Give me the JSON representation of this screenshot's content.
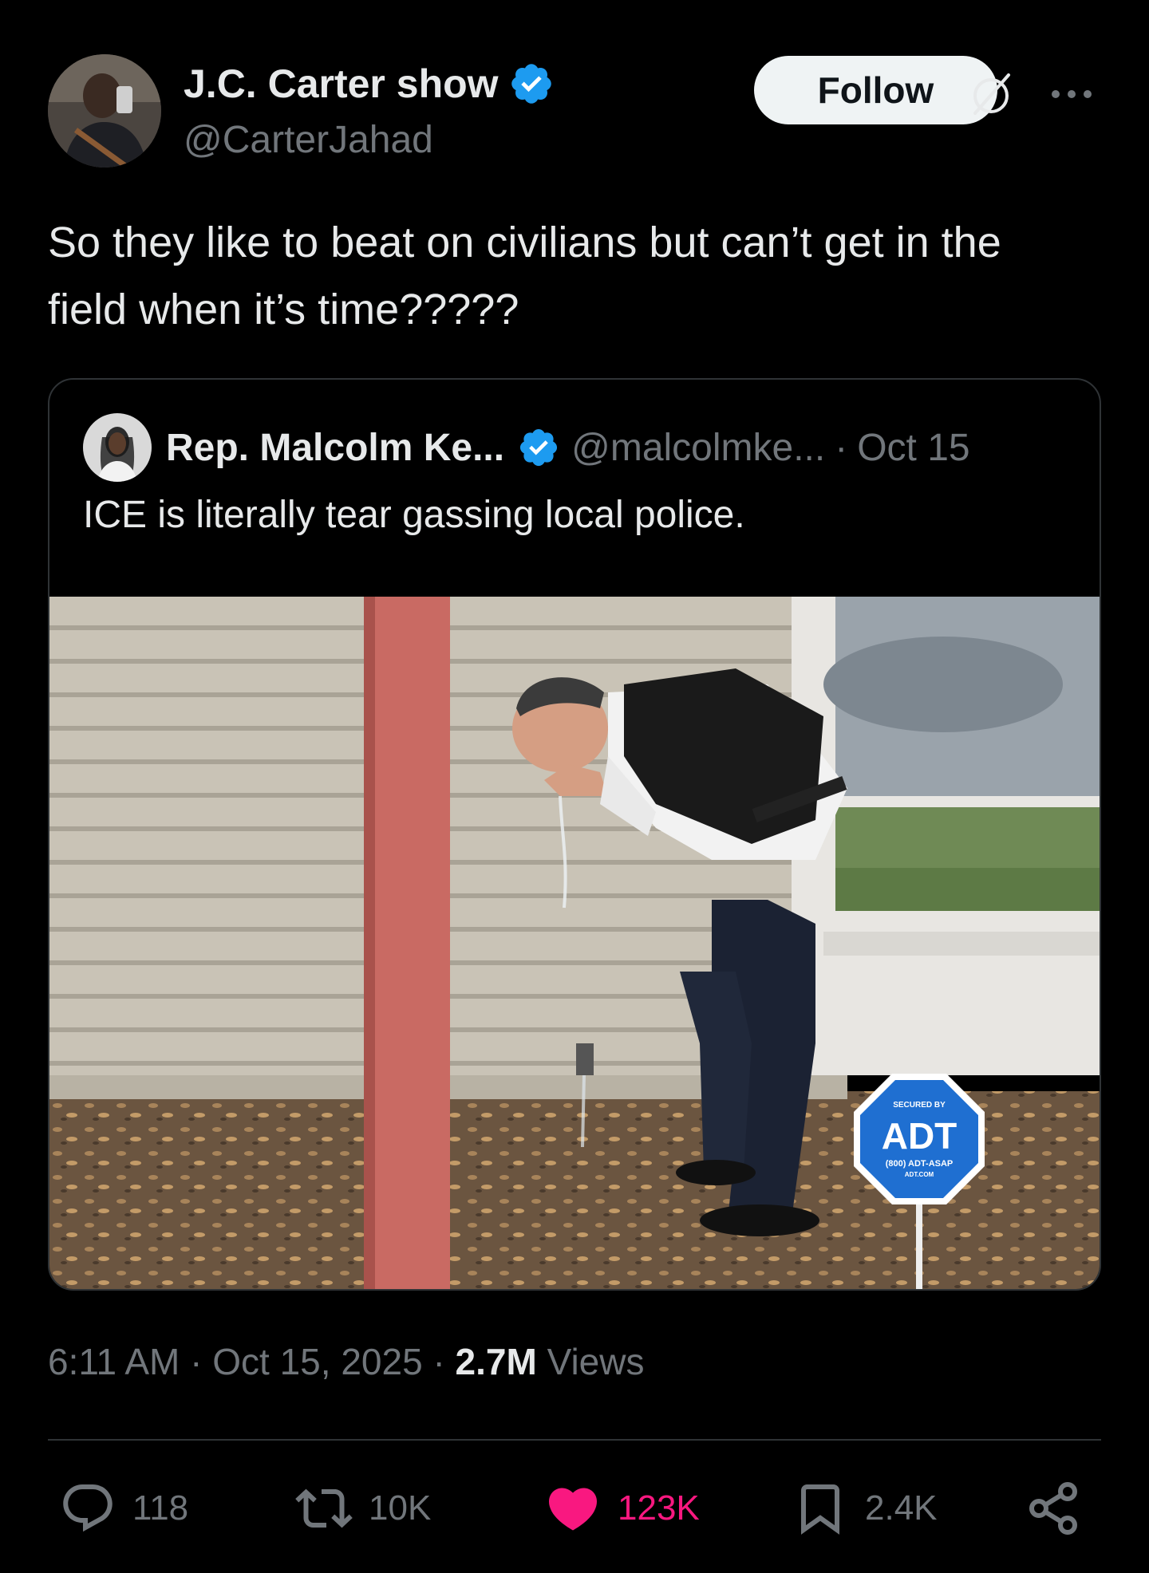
{
  "post": {
    "author": {
      "display_name": "J.C. Carter show",
      "handle": "@CarterJahad",
      "verified": true
    },
    "follow_label": "Follow",
    "text": "So they like to beat on civilians but can’t get in the field when it’s time?????",
    "quoted": {
      "display_name": "Rep. Malcolm Ke...",
      "handle": "@malcolmke...",
      "separator": "·",
      "date": "Oct 15",
      "text": "ICE is literally tear gassing local police.",
      "image": {
        "sign_top": "SECURED BY",
        "sign_brand": "ADT",
        "sign_phone": "(800) ADT-ASAP",
        "sign_site": "ADT.COM"
      }
    },
    "meta": {
      "time": "6:11 AM",
      "sep1": "·",
      "date": "Oct 15, 2025",
      "sep2": "·",
      "views_count": "2.7M",
      "views_label": "Views"
    },
    "actions": {
      "replies": "118",
      "reposts": "10K",
      "likes": "123K",
      "bookmarks": "2.4K"
    }
  },
  "colors": {
    "background": "#000000",
    "text_primary": "#e7e9ea",
    "text_secondary": "#71767b",
    "verified_blue": "#1d9bf0",
    "like_pink": "#f91880",
    "follow_button": "#eff3f4"
  }
}
